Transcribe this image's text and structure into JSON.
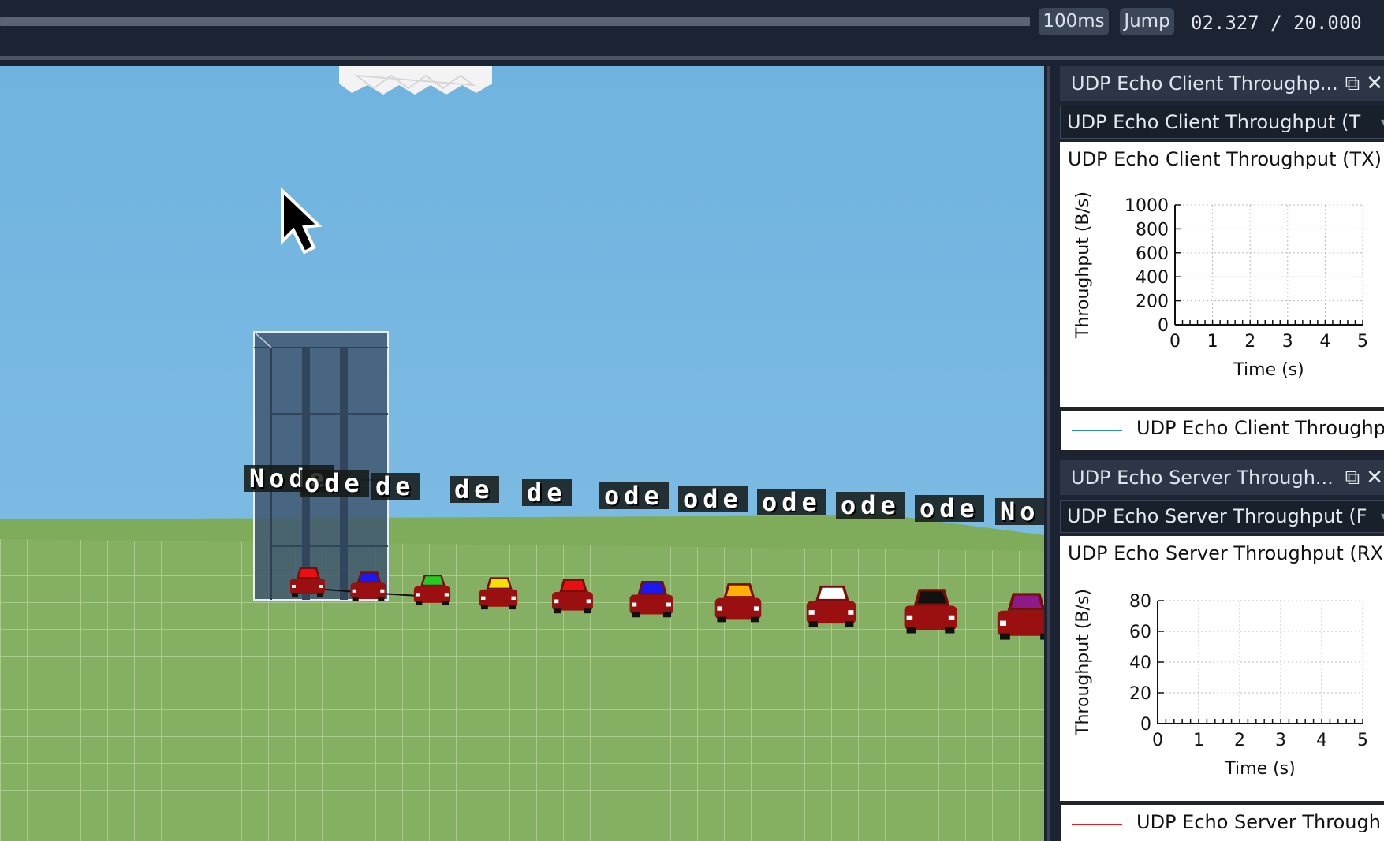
{
  "toolbar": {
    "step_label": "100ms",
    "jump_label": "Jump",
    "time_readout": "02.327 / 20.000"
  },
  "viewport": {
    "node_label": "Node",
    "node_labels_visible": [
      "Node",
      "ode",
      "de",
      "de",
      "de",
      "ode",
      "ode",
      "ode",
      "ode",
      "ode",
      "No"
    ],
    "car_roof_colors": [
      "#e81010",
      "#1a1aee",
      "#22cc22",
      "#f2e000",
      "#e81010",
      "#1a1aee",
      "#ffb000",
      "#ffffff",
      "#111111",
      "#8b1a8b"
    ],
    "car_body_color": "#9a1010",
    "sky_color": "#72b4df",
    "ground_color": "#82ad5e"
  },
  "plots": [
    {
      "window_title": "UDP Echo Client Throughp...",
      "select_value": "UDP Echo Client Throughput (T",
      "title": "UDP Echo Client Throughput (TX)",
      "legend": "UDP Echo Client Throughp",
      "legend_color": "#2a8fb8",
      "chart_data": {
        "type": "line",
        "title": "UDP Echo Client Throughput (TX)",
        "xlabel": "Time (s)",
        "ylabel": "Throughput (B/s)",
        "xlim": [
          0,
          5
        ],
        "ylim": [
          0,
          1000
        ],
        "x_ticks": [
          "0",
          "1",
          "2",
          "3",
          "4",
          "5"
        ],
        "y_ticks": [
          "0",
          "200",
          "400",
          "600",
          "800",
          "1000"
        ],
        "grid": true,
        "series": [
          {
            "name": "UDP Echo Client Throughp",
            "x": [],
            "y": []
          }
        ]
      }
    },
    {
      "window_title": "UDP Echo Server Through...",
      "select_value": "UDP Echo Server Throughput (F",
      "title": "UDP Echo Server Throughput (RX)",
      "legend": "UDP Echo Server Through",
      "legend_color": "#e02020",
      "chart_data": {
        "type": "line",
        "title": "UDP Echo Server Throughput (RX)",
        "xlabel": "Time (s)",
        "ylabel": "Throughput (B/s)",
        "xlim": [
          0,
          5
        ],
        "ylim": [
          0,
          80
        ],
        "x_ticks": [
          "0",
          "1",
          "2",
          "3",
          "4",
          "5"
        ],
        "y_ticks": [
          "0",
          "20",
          "40",
          "60",
          "80"
        ],
        "grid": true,
        "series": [
          {
            "name": "UDP Echo Server Through",
            "x": [],
            "y": []
          }
        ]
      }
    }
  ]
}
